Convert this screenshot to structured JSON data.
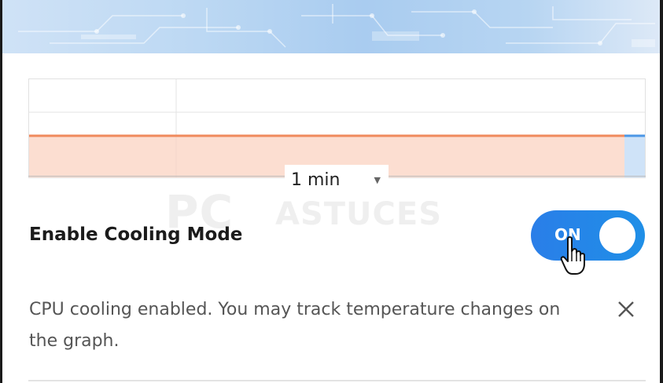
{
  "graph": {
    "interval": "1 min"
  },
  "setting": {
    "title": "Enable Cooling Mode",
    "toggle_state": "ON",
    "toggle_color": "#2a7ee8"
  },
  "notice": {
    "message": "CPU cooling enabled. You may track temperature changes on the graph.",
    "close_icon": "close-icon"
  },
  "watermark": {
    "big": "PC",
    "small": "ASTUCES"
  },
  "colors": {
    "graph_line": "#f08a5d",
    "graph_fill": "#fdd9c9",
    "accent": "#2a7ee8"
  }
}
